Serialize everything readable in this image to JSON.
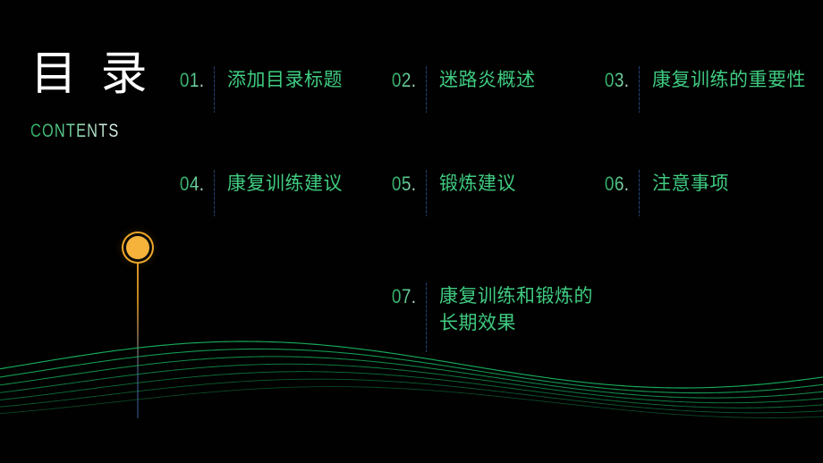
{
  "slide": {
    "background_color": "#000000",
    "accent_green": "#3fcb80",
    "accent_orange": "#f5b33c",
    "rule_color": "#2e5492"
  },
  "title": {
    "cn": "目 录",
    "en": "CONTENTS"
  },
  "contents": {
    "items": [
      {
        "number": "01.",
        "label": "添加目录标题"
      },
      {
        "number": "02.",
        "label": "迷路炎概述"
      },
      {
        "number": "03.",
        "label": "康复训练的重要性"
      },
      {
        "number": "04.",
        "label": "康复训练建议"
      },
      {
        "number": "05.",
        "label": "锻炼建议"
      },
      {
        "number": "06.",
        "label": "注意事项"
      },
      {
        "number": "07.",
        "label": "康复训练和锻炼的\n长期效果"
      }
    ]
  },
  "decor": {
    "marker_name": "timeline-marker",
    "wave_name": "wave-field",
    "wave_color": "#19b35f",
    "wave_lines": 7
  }
}
